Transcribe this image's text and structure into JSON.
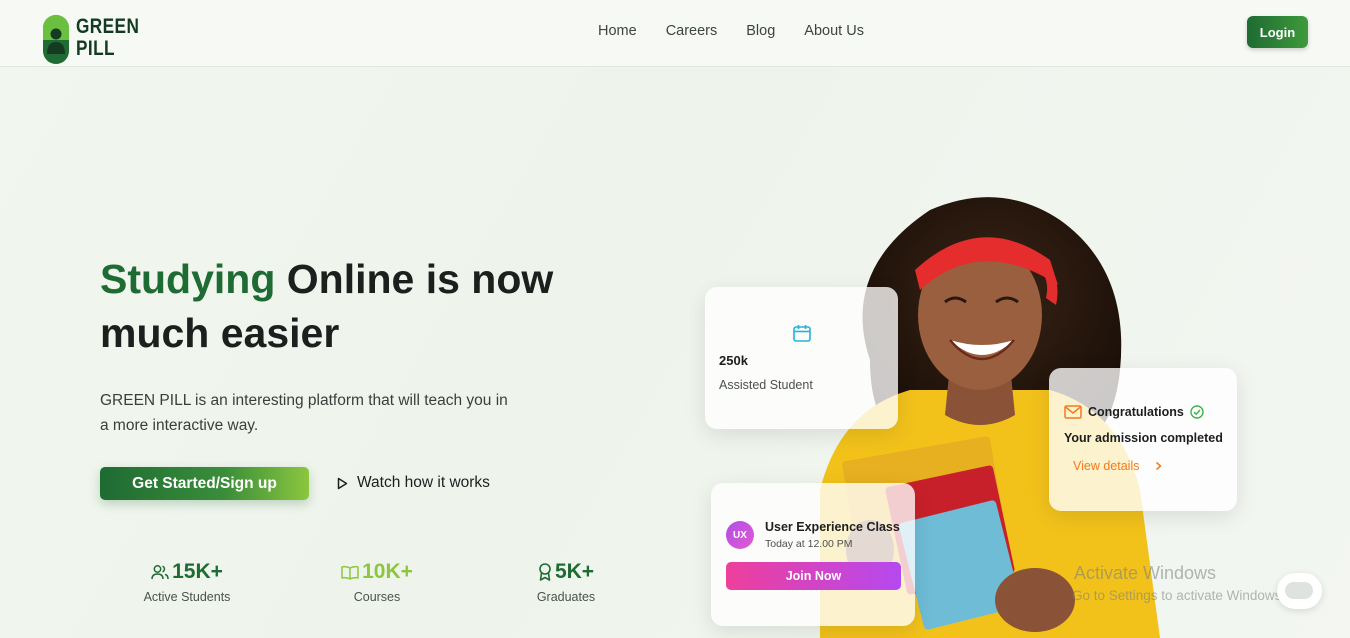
{
  "brand": {
    "name_line1": "GREEN",
    "name_line2": "PILL"
  },
  "nav": {
    "items": [
      "Home",
      "Careers",
      "Blog",
      "About Us"
    ],
    "login_label": "Login"
  },
  "hero": {
    "title_highlight": "Studying",
    "title_rest": " Online is now much easier",
    "description": "GREEN PILL is an interesting platform that will teach you in a more interactive way.",
    "cta_label": "Get Started/Sign up",
    "watch_label": "Watch how it works"
  },
  "stats": [
    {
      "value": "15K+",
      "label": "Active Students",
      "icon": "users-icon",
      "color": "#1e6b33"
    },
    {
      "value": "10K+",
      "label": "Courses",
      "icon": "book-icon",
      "color": "#8cc63f"
    },
    {
      "value": "5K+",
      "label": "Graduates",
      "icon": "award-icon",
      "color": "#1e6b33"
    }
  ],
  "cards": {
    "assisted": {
      "value": "250k",
      "label": "Assisted Student",
      "icon": "calendar-icon"
    },
    "admission": {
      "title": "Congratulations",
      "message": "Your admission completed",
      "link": "View details",
      "icon": "mail-icon"
    },
    "class": {
      "badge": "UX",
      "title": "User Experience Class",
      "time": "Today at 12.00 PM",
      "button": "Join Now"
    }
  },
  "watermark": {
    "line1": "Activate Windows",
    "line2": "Go to Settings to activate Windows."
  },
  "colors": {
    "brand_green": "#1e6b33",
    "light_green": "#8cc63f",
    "orange": "#f37a1f",
    "pink": "#ee3f9b",
    "purple": "#b549f0",
    "cyan": "#22b5d6"
  }
}
